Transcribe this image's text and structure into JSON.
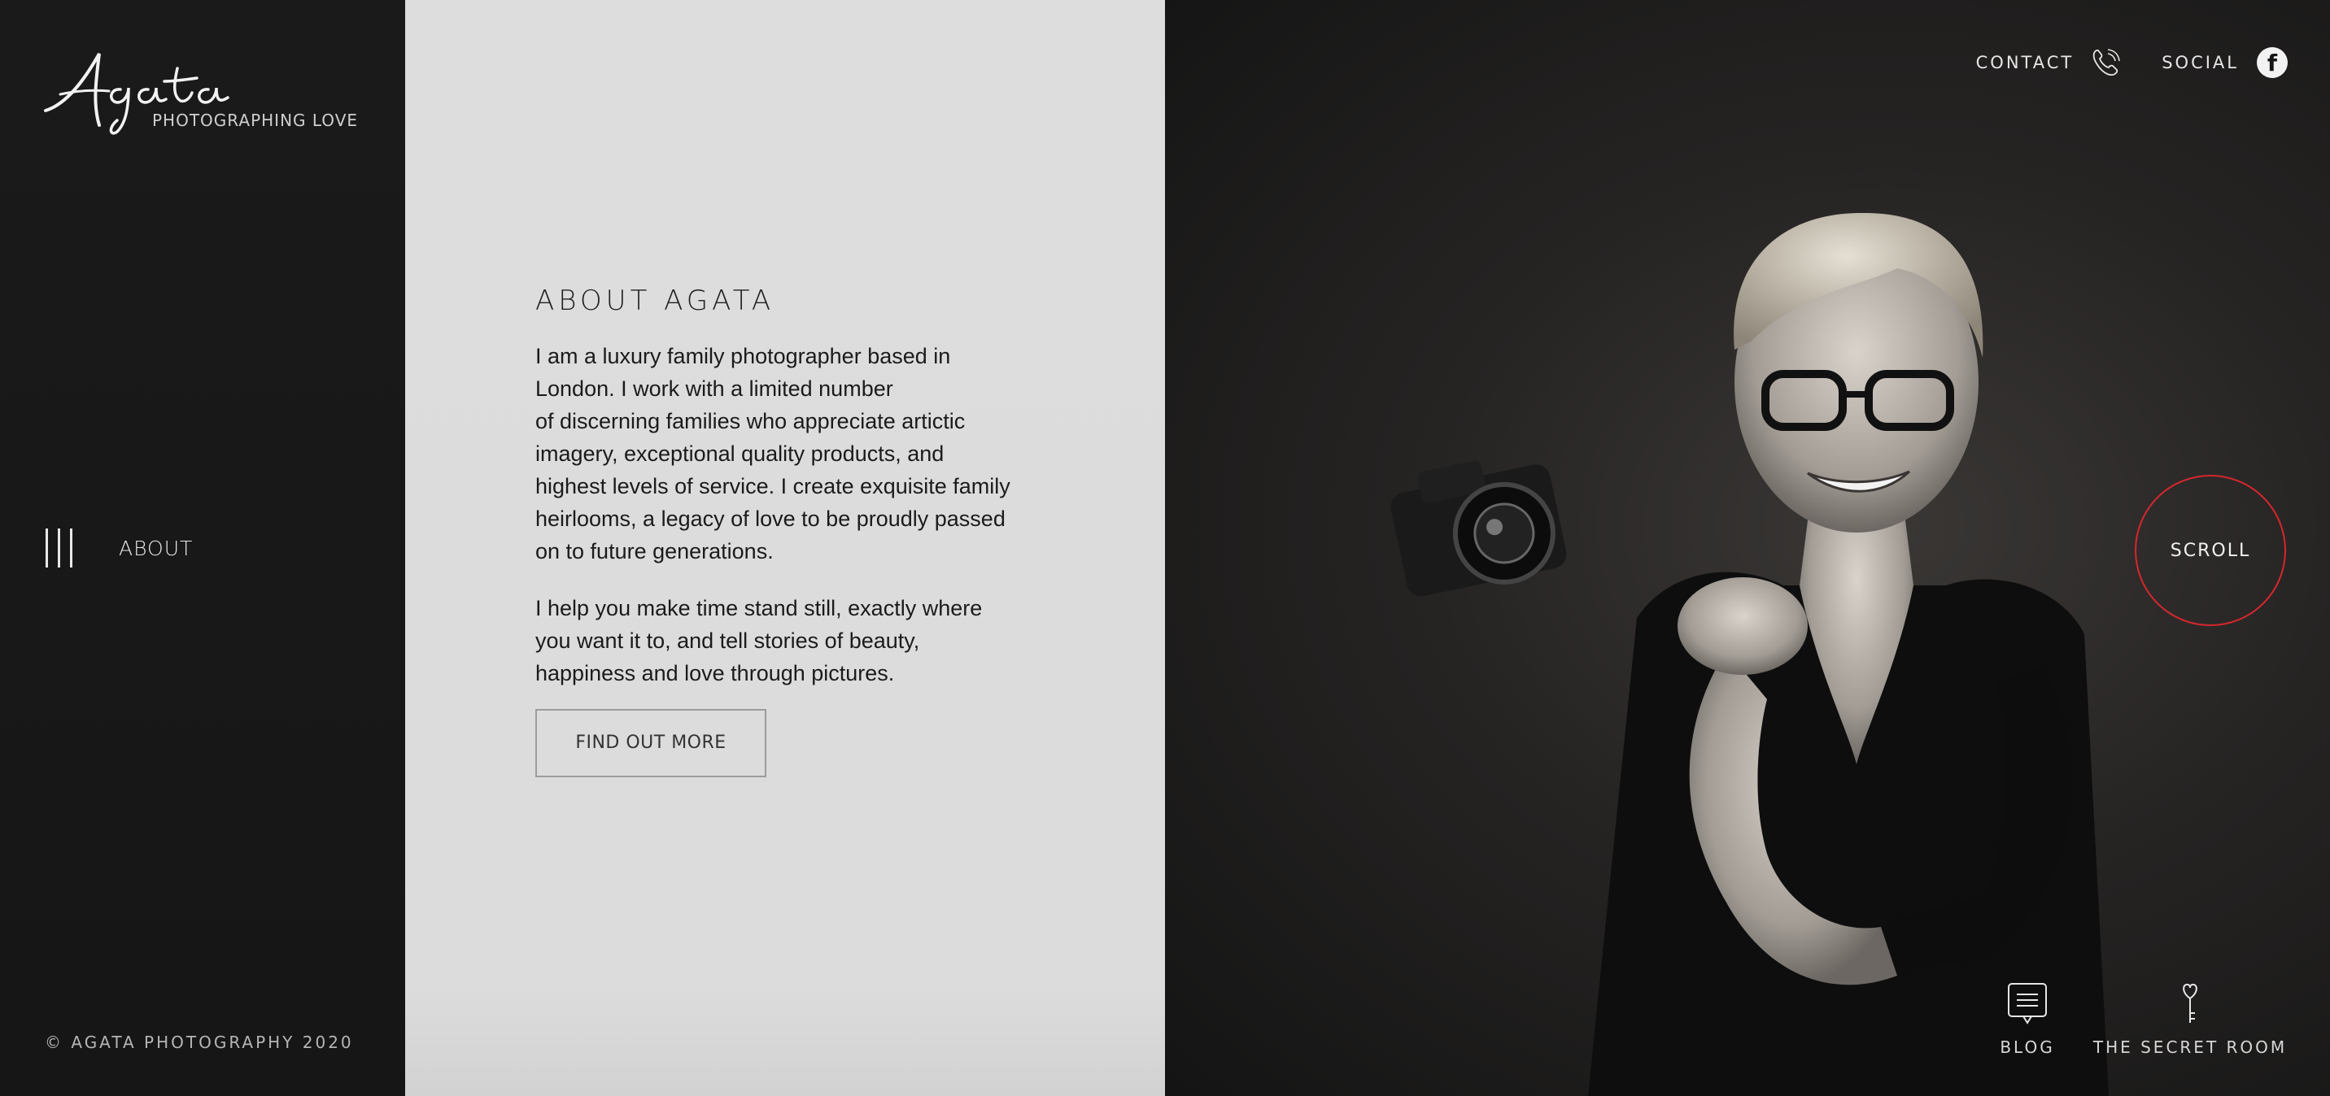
{
  "brand": {
    "logo_script": "Agata",
    "tagline": "PHOTOGRAPHING LOVE"
  },
  "sidebar": {
    "menu_label": "ABOUT",
    "copyright": "© AGATA PHOTOGRAPHY 2020"
  },
  "about": {
    "heading": "ABOUT AGATA",
    "paragraph_1": "I am a luxury family photographer based in\nLondon. I work with a limited number\nof discerning families who appreciate artictic\nimagery, exceptional quality products, and\nhighest levels of service. I create exquisite family\nheirlooms, a legacy of love to be proudly passed\non to future generations.",
    "paragraph_2": "I help you make time stand still, exactly where\nyou want it to, and tell stories of beauty,\nhappiness and love through pictures.",
    "button_label": "FIND OUT MORE"
  },
  "topnav": {
    "contact_label": "CONTACT",
    "social_label": "SOCIAL",
    "contact_icon": "phone-icon",
    "social_icon": "facebook-icon"
  },
  "scroll": {
    "label": "SCROLL",
    "accent_color": "#d6272d"
  },
  "bottom_links": {
    "blog_label": "BLOG",
    "blog_icon": "speech-bubble-icon",
    "secret_label": "THE SECRET ROOM",
    "secret_icon": "heart-key-icon"
  },
  "colors": {
    "sidebar_bg": "#161616",
    "panel_bg": "#dddddd",
    "accent": "#d6272d"
  }
}
